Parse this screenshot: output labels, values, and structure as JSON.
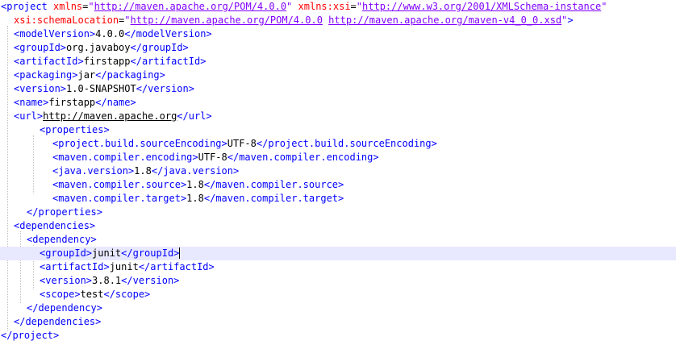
{
  "colors": {
    "tag": "#0000ff",
    "attr_name": "#ff0000",
    "attr_value": "#8000ff",
    "text": "#000000",
    "current_line": "#e8e8ff",
    "background": "#ffffff"
  },
  "current_line_index": 18,
  "lines": [
    {
      "indent": 0,
      "segments": [
        {
          "type": "tag",
          "text": "<project"
        },
        {
          "type": "plain",
          "text": " "
        },
        {
          "type": "attr_name",
          "text": "xmlns"
        },
        {
          "type": "plain",
          "text": "="
        },
        {
          "type": "attr_value",
          "text": "\""
        },
        {
          "type": "attr_value_link",
          "text": "http://maven.apache.org/POM/4.0.0"
        },
        {
          "type": "attr_value",
          "text": "\""
        },
        {
          "type": "plain",
          "text": " "
        },
        {
          "type": "attr_name",
          "text": "xmlns:xsi"
        },
        {
          "type": "plain",
          "text": "="
        },
        {
          "type": "attr_value",
          "text": "\""
        },
        {
          "type": "attr_value_link",
          "text": "http://www.w3.org/2001/XMLSchema-instance"
        },
        {
          "type": "attr_value",
          "text": "\""
        }
      ]
    },
    {
      "indent": 1,
      "segments": [
        {
          "type": "attr_name",
          "text": "xsi:schemaLocation"
        },
        {
          "type": "plain",
          "text": "="
        },
        {
          "type": "attr_value",
          "text": "\""
        },
        {
          "type": "attr_value_link",
          "text": "http://maven.apache.org/POM/4.0.0"
        },
        {
          "type": "attr_value",
          "text": " "
        },
        {
          "type": "attr_value_link",
          "text": "http://maven.apache.org/maven-v4_0_0.xsd"
        },
        {
          "type": "attr_value",
          "text": "\""
        },
        {
          "type": "tag",
          "text": ">"
        }
      ]
    },
    {
      "indent": 1,
      "segments": [
        {
          "type": "tag",
          "text": "<modelVersion>"
        },
        {
          "type": "text",
          "text": "4.0.0"
        },
        {
          "type": "tag",
          "text": "</modelVersion>"
        }
      ]
    },
    {
      "indent": 1,
      "segments": [
        {
          "type": "tag",
          "text": "<groupId>"
        },
        {
          "type": "text",
          "text": "org.javaboy"
        },
        {
          "type": "tag",
          "text": "</groupId>"
        }
      ]
    },
    {
      "indent": 1,
      "segments": [
        {
          "type": "tag",
          "text": "<artifactId>"
        },
        {
          "type": "text",
          "text": "firstapp"
        },
        {
          "type": "tag",
          "text": "</artifactId>"
        }
      ]
    },
    {
      "indent": 1,
      "segments": [
        {
          "type": "tag",
          "text": "<packaging>"
        },
        {
          "type": "text",
          "text": "jar"
        },
        {
          "type": "tag",
          "text": "</packaging>"
        }
      ]
    },
    {
      "indent": 1,
      "segments": [
        {
          "type": "tag",
          "text": "<version>"
        },
        {
          "type": "text",
          "text": "1.0-SNAPSHOT"
        },
        {
          "type": "tag",
          "text": "</version>"
        }
      ]
    },
    {
      "indent": 1,
      "segments": [
        {
          "type": "tag",
          "text": "<name>"
        },
        {
          "type": "text",
          "text": "firstapp"
        },
        {
          "type": "tag",
          "text": "</name>"
        }
      ]
    },
    {
      "indent": 1,
      "segments": [
        {
          "type": "tag",
          "text": "<url>"
        },
        {
          "type": "link",
          "text": "http://maven.apache.org"
        },
        {
          "type": "tag",
          "text": "</url>"
        }
      ]
    },
    {
      "indent": 3,
      "segments": [
        {
          "type": "tag",
          "text": "<properties>"
        }
      ]
    },
    {
      "indent": 4,
      "segments": [
        {
          "type": "tag",
          "text": "<project.build.sourceEncoding>"
        },
        {
          "type": "text",
          "text": "UTF-8"
        },
        {
          "type": "tag",
          "text": "</project.build.sourceEncoding>"
        }
      ]
    },
    {
      "indent": 4,
      "segments": [
        {
          "type": "tag",
          "text": "<maven.compiler.encoding>"
        },
        {
          "type": "text",
          "text": "UTF-8"
        },
        {
          "type": "tag",
          "text": "</maven.compiler.encoding>"
        }
      ]
    },
    {
      "indent": 4,
      "segments": [
        {
          "type": "tag",
          "text": "<java.version>"
        },
        {
          "type": "text",
          "text": "1.8"
        },
        {
          "type": "tag",
          "text": "</java.version>"
        }
      ]
    },
    {
      "indent": 4,
      "segments": [
        {
          "type": "tag",
          "text": "<maven.compiler.source>"
        },
        {
          "type": "text",
          "text": "1.8"
        },
        {
          "type": "tag",
          "text": "</maven.compiler.source>"
        }
      ]
    },
    {
      "indent": 4,
      "segments": [
        {
          "type": "tag",
          "text": "<maven.compiler.target>"
        },
        {
          "type": "text",
          "text": "1.8"
        },
        {
          "type": "tag",
          "text": "</maven.compiler.target>"
        }
      ]
    },
    {
      "indent": 2,
      "segments": [
        {
          "type": "tag",
          "text": "</properties>"
        }
      ]
    },
    {
      "indent": 1,
      "segments": [
        {
          "type": "tag",
          "text": "<dependencies>"
        }
      ]
    },
    {
      "indent": 2,
      "segments": [
        {
          "type": "tag",
          "text": "<dependency>"
        }
      ]
    },
    {
      "indent": 3,
      "segments": [
        {
          "type": "tag",
          "text": "<groupId>"
        },
        {
          "type": "text",
          "text": "junit"
        },
        {
          "type": "tag",
          "text": "</groupId>"
        }
      ]
    },
    {
      "indent": 3,
      "segments": [
        {
          "type": "tag",
          "text": "<artifactId>"
        },
        {
          "type": "text",
          "text": "junit"
        },
        {
          "type": "tag",
          "text": "</artifactId>"
        }
      ]
    },
    {
      "indent": 3,
      "segments": [
        {
          "type": "tag",
          "text": "<version>"
        },
        {
          "type": "text",
          "text": "3.8.1"
        },
        {
          "type": "tag",
          "text": "</version>"
        }
      ]
    },
    {
      "indent": 3,
      "segments": [
        {
          "type": "tag",
          "text": "<scope>"
        },
        {
          "type": "text",
          "text": "test"
        },
        {
          "type": "tag",
          "text": "</scope>"
        }
      ]
    },
    {
      "indent": 2,
      "segments": [
        {
          "type": "tag",
          "text": "</dependency>"
        }
      ]
    },
    {
      "indent": 1,
      "segments": [
        {
          "type": "tag",
          "text": "</dependencies>"
        }
      ]
    },
    {
      "indent": 0,
      "segments": [
        {
          "type": "tag",
          "text": "</project>"
        }
      ]
    }
  ]
}
